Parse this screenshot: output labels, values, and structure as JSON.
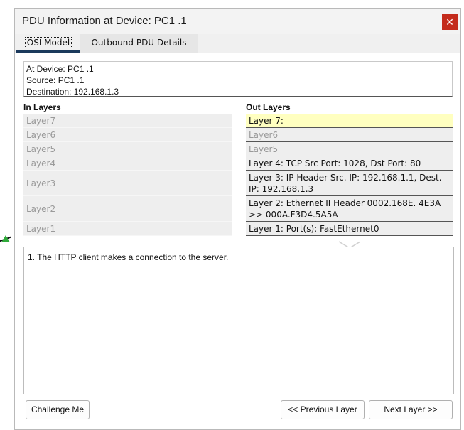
{
  "window": {
    "title": "PDU Information at Device: PC1 .1",
    "close_glyph": "✕"
  },
  "tabs": [
    {
      "label": "OSI Model",
      "active": true
    },
    {
      "label": "Outbound PDU Details",
      "active": false
    }
  ],
  "info": {
    "device": "At Device: PC1 .1",
    "source": "Source: PC1 .1",
    "destination": "Destination: 192.168.1.3"
  },
  "in_layers": {
    "heading": "In Layers",
    "items": [
      "Layer7",
      "Layer6",
      "Layer5",
      "Layer4",
      "Layer3",
      "Layer2",
      "Layer1"
    ]
  },
  "out_layers": {
    "heading": "Out Layers",
    "items": [
      "Layer 7:",
      "Layer6",
      "Layer5",
      "Layer 4: TCP Src Port: 1028, Dst Port: 80",
      "Layer 3: IP Header Src. IP: 192.168.1.1, Dest. IP: 192.168.1.3",
      "Layer 2: Ethernet II Header 0002.168E. 4E3A >> 000A.F3D4.5A5A",
      "Layer 1: Port(s): FastEthernet0"
    ],
    "selected_index": 0
  },
  "description": "1. The HTTP client makes a connection to the server.",
  "buttons": {
    "challenge": "Challenge Me",
    "previous": "<< Previous Layer",
    "next": "Next Layer >>"
  },
  "colors": {
    "close_button": "#c42b1c",
    "selected_layer": "#ffffc0",
    "tab_underline": "#1b3a5c"
  }
}
